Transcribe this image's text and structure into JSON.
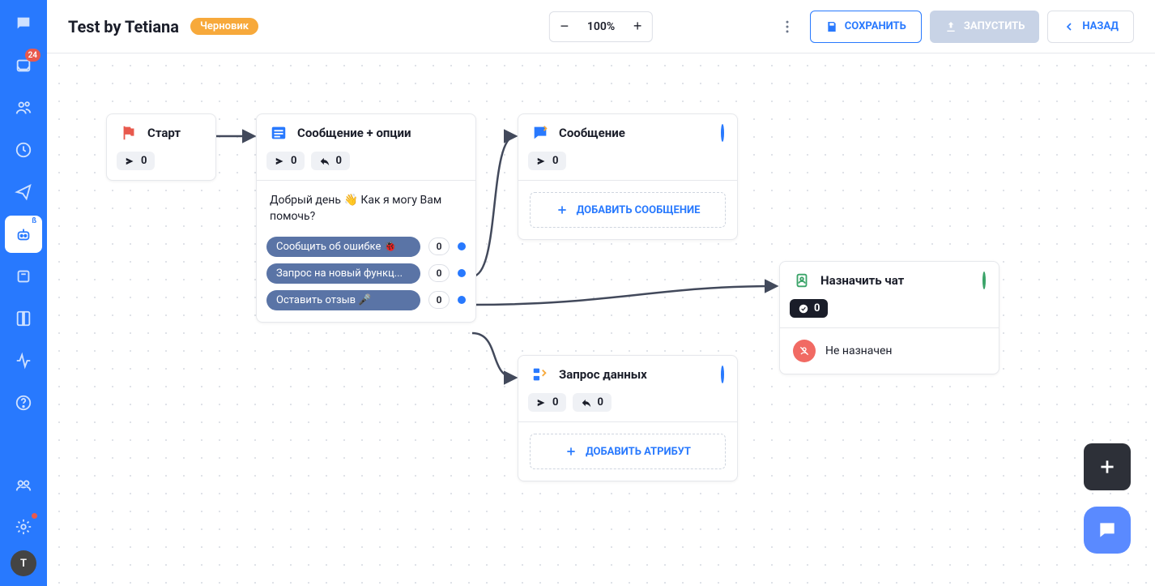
{
  "sidebar": {
    "inbox_badge": "24",
    "avatar_initial": "T"
  },
  "topbar": {
    "title": "Test by Tetiana",
    "draft_label": "Черновик",
    "zoom_value": "100%",
    "save_label": "СОХРАНИТЬ",
    "launch_label": "ЗАПУСТИТЬ",
    "back_label": "НАЗАД"
  },
  "nodes": {
    "start": {
      "title": "Старт",
      "sent": "0"
    },
    "msg_options": {
      "title": "Сообщение + опции",
      "sent": "0",
      "replies": "0",
      "body": "Добрый день 👋 Как я могу Вам помочь?",
      "options": [
        {
          "label": "Сообщить об ошибке 🐞",
          "count": "0"
        },
        {
          "label": "Запрос на новый функц...",
          "count": "0"
        },
        {
          "label": "Оставить отзыв 🎤",
          "count": "0"
        }
      ]
    },
    "message": {
      "title": "Сообщение",
      "sent": "0",
      "add_label": "ДОБАВИТЬ СООБЩЕНИЕ"
    },
    "data_request": {
      "title": "Запрос данных",
      "sent": "0",
      "replies": "0",
      "add_label": "ДОБАВИТЬ АТРИБУТ"
    },
    "assign": {
      "title": "Назначить чат",
      "count": "0",
      "status": "Не назначен"
    }
  }
}
